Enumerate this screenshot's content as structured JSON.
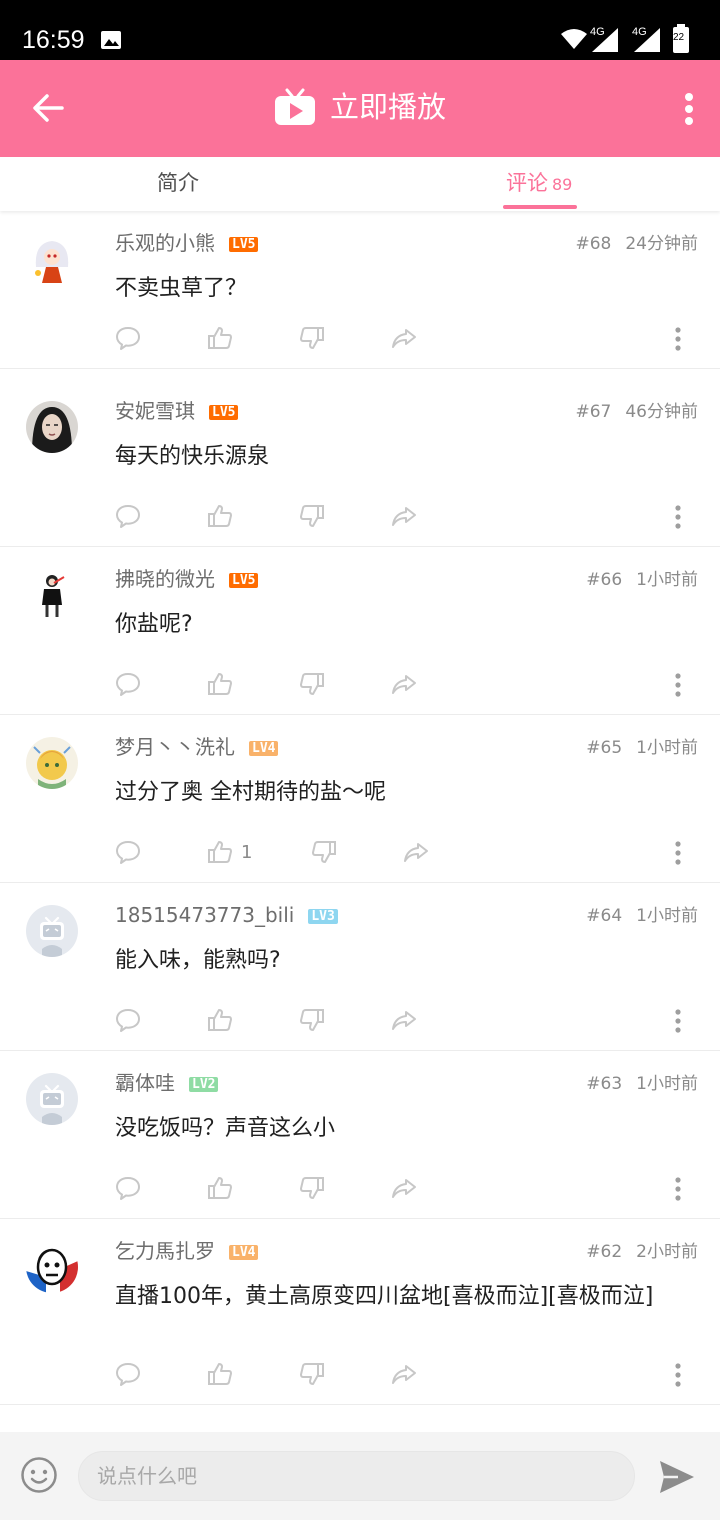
{
  "status_bar": {
    "time": "16:59",
    "signal_labels": [
      "4G",
      "4G"
    ],
    "battery": "22"
  },
  "header": {
    "title": "立即播放",
    "back_icon": "arrow-left-icon",
    "brand_icon": "tv-icon",
    "more_icon": "vertical-dots-icon"
  },
  "tabs": {
    "intro_label": "简介",
    "comments_label": "评论",
    "comments_count": "89"
  },
  "colors": {
    "accent": "#fb7299",
    "lv2": "#8fdca4",
    "lv3": "#8ed6f0",
    "lv4": "#f9b26a",
    "lv5": "#ff6c00"
  },
  "comments": [
    {
      "username": "乐观的小熊",
      "level": "LV5",
      "floor": "#68",
      "time": "24分钟前",
      "text": "不卖虫草了？",
      "likes": ""
    },
    {
      "username": "安妮雪琪",
      "level": "LV5",
      "floor": "#67",
      "time": "46分钟前",
      "text": "每天的快乐源泉",
      "likes": ""
    },
    {
      "username": "拂晓的微光",
      "level": "LV5",
      "floor": "#66",
      "time": "1小时前",
      "text": "你盐呢?",
      "likes": ""
    },
    {
      "username": "梦月丶丶洗礼",
      "level": "LV4",
      "floor": "#65",
      "time": "1小时前",
      "text": "过分了奥 全村期待的盐～呢",
      "likes": "1"
    },
    {
      "username": "18515473773_bili",
      "level": "LV3",
      "floor": "#64",
      "time": "1小时前",
      "text": "能入味，能熟吗?",
      "likes": ""
    },
    {
      "username": "霸体哇",
      "level": "LV2",
      "floor": "#63",
      "time": "1小时前",
      "text": "没吃饭吗？声音这么小",
      "likes": ""
    },
    {
      "username": "乞力馬扎罗",
      "level": "LV4",
      "floor": "#62",
      "time": "2小时前",
      "text": "直播100年，黄土高原变四川盆地[喜极而泣][喜极而泣]",
      "likes": ""
    }
  ],
  "action_icons": [
    "reply-icon",
    "thumbs-up-icon",
    "thumbs-down-icon",
    "share-icon",
    "more-dots-icon"
  ],
  "input_bar": {
    "placeholder": "说点什么吧",
    "emoji_icon": "emoji-icon",
    "send_icon": "send-icon"
  }
}
